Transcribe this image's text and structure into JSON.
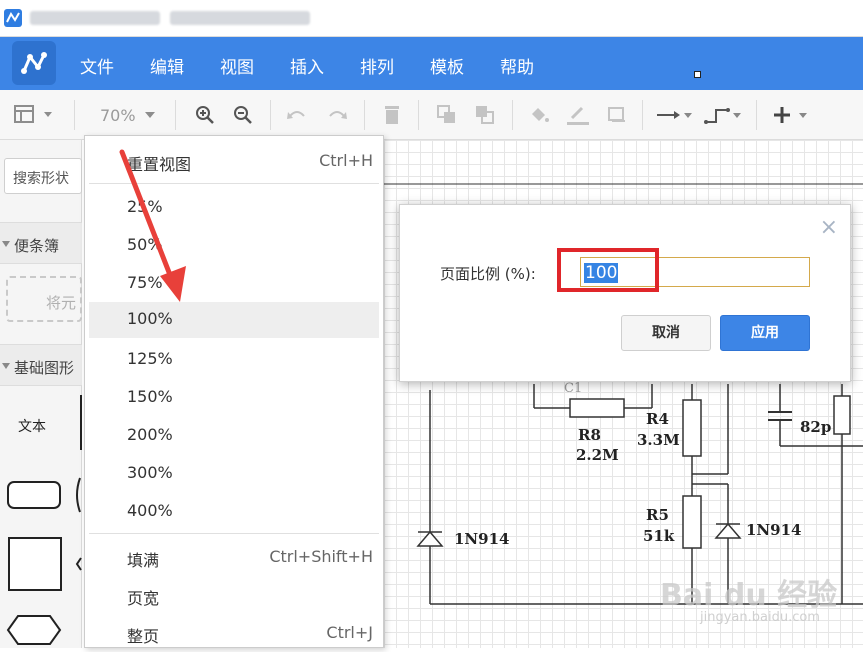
{
  "menubar": {
    "items": [
      "文件",
      "编辑",
      "视图",
      "插入",
      "排列",
      "模板",
      "帮助"
    ]
  },
  "toolbar": {
    "zoom": "70%"
  },
  "sidebar": {
    "search_placeholder": "搜索形状",
    "sections": [
      "便条簿",
      "基础图形"
    ],
    "drop_hint": "将元",
    "shape_text": "文本"
  },
  "zoom_menu": {
    "items": [
      {
        "label": "重置视图",
        "shortcut": "Ctrl+H"
      },
      {
        "label": "25%",
        "shortcut": ""
      },
      {
        "label": "50%",
        "shortcut": ""
      },
      {
        "label": "75%",
        "shortcut": ""
      },
      {
        "label": "100%",
        "shortcut": ""
      },
      {
        "label": "125%",
        "shortcut": ""
      },
      {
        "label": "150%",
        "shortcut": ""
      },
      {
        "label": "200%",
        "shortcut": ""
      },
      {
        "label": "300%",
        "shortcut": ""
      },
      {
        "label": "400%",
        "shortcut": ""
      },
      {
        "label": "填满",
        "shortcut": "Ctrl+Shift+H"
      },
      {
        "label": "页宽",
        "shortcut": ""
      },
      {
        "label": "整页",
        "shortcut": "Ctrl+J"
      }
    ]
  },
  "dialog": {
    "label": "页面比例 (%):",
    "value": "100",
    "cancel": "取消",
    "apply": "应用",
    "close": "×"
  },
  "circuit": {
    "r8": "R8",
    "r8_val": "2.2M",
    "r4": "R4",
    "r4_val": "3.3M",
    "r5": "R5",
    "r5_val": "51k",
    "d1": "1N914",
    "d2": "1N914",
    "cap": "82p",
    "c1": "C1"
  },
  "watermark": {
    "logo": "Bai du 经验",
    "url": "jingyan.baidu.com"
  },
  "colors": {
    "menubar": "#3d85e6",
    "highlight": "#3584e4",
    "annotation_red": "#e0262a"
  }
}
